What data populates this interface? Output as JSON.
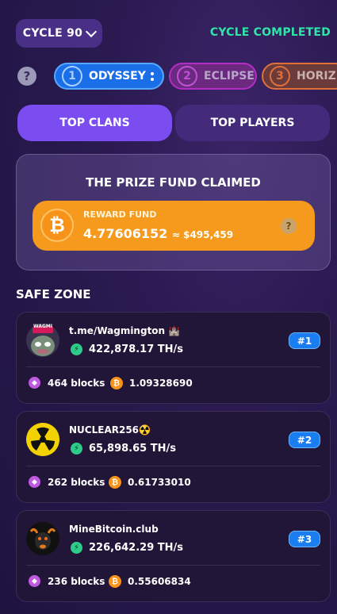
{
  "header": {
    "cycle_label": "CYCLE 90",
    "status": "CYCLE COMPLETED"
  },
  "leagues": [
    {
      "num": "1",
      "name": "ODYSSEY"
    },
    {
      "num": "2",
      "name": "ECLIPSE"
    },
    {
      "num": "3",
      "name": "HORIZ"
    }
  ],
  "tabs": {
    "clans": "TOP CLANS",
    "players": "TOP PLAYERS"
  },
  "prize": {
    "title": "THE PRIZE FUND CLAIMED",
    "label": "REWARD FUND",
    "amount": "4.77606152",
    "approx": "≈ $495,459",
    "help": "?"
  },
  "help_icon": "?",
  "section_title": "SAFE ZONE",
  "clans": [
    {
      "name": "t.me/Wagmington 🏰",
      "hashrate": "422,878.17 TH/s",
      "rank": "#1",
      "blocks": "464 blocks",
      "btc": "1.09328690",
      "avatar_text": "WAGMI"
    },
    {
      "name": "NUCLEAR256☢️",
      "hashrate": "65,898.65 TH/s",
      "rank": "#2",
      "blocks": "262 blocks",
      "btc": "0.61733010"
    },
    {
      "name": "MineBitcoin.club",
      "hashrate": "226,642.29 TH/s",
      "rank": "#3",
      "blocks": "236 blocks",
      "btc": "0.55606834"
    }
  ],
  "icons": {
    "hash": "⚡",
    "btc": "₿",
    "cube": "◆"
  },
  "colors": {
    "accent_purple": "#7b4cf0",
    "status_green": "#2ee6a8",
    "reward_orange": "#f59a1c",
    "rank_blue": "#1a7df0"
  }
}
